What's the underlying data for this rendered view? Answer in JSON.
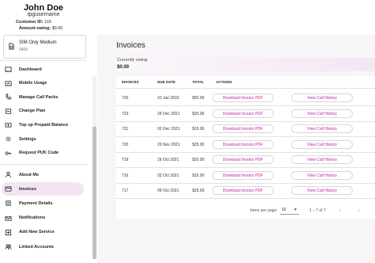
{
  "profile": {
    "name": "John Doe",
    "username": "tpgusername",
    "customer_id_label": "Customer ID:",
    "customer_id": "115",
    "amount_owing_label": "Amount owing:",
    "amount_owing": "$0.00"
  },
  "plan": {
    "name": "SIM Only Medium",
    "number": "0406",
    "icon": "sim-card-icon"
  },
  "nav_primary": [
    {
      "label": "Dashboard",
      "icon": "dashboard-icon"
    },
    {
      "label": "Mobile Usage",
      "icon": "usage-icon"
    },
    {
      "label": "Manage Call Packs",
      "icon": "call-packs-icon"
    },
    {
      "label": "Change Plan",
      "icon": "change-plan-icon"
    },
    {
      "label": "Top up Prepaid Balance",
      "icon": "top-up-icon"
    },
    {
      "label": "Settings",
      "icon": "gear-icon"
    },
    {
      "label": "Request PUK Code",
      "icon": "key-icon"
    }
  ],
  "nav_secondary": [
    {
      "label": "About Me",
      "icon": "person-icon"
    },
    {
      "label": "Invoices",
      "icon": "invoice-icon",
      "active": true
    },
    {
      "label": "Payment Details",
      "icon": "payment-icon"
    },
    {
      "label": "Notifications",
      "icon": "notifications-icon"
    },
    {
      "label": "Add New Service",
      "icon": "add-icon"
    },
    {
      "label": "Linked Accounts",
      "icon": "linked-accounts-icon"
    }
  ],
  "page": {
    "title": "Invoices",
    "owing_label": "Currently owing",
    "owing_value": "$0.00"
  },
  "table": {
    "headers": [
      "INVOICES",
      "DUE DATE",
      "TOTAL",
      "ACTIONS"
    ],
    "download_label": "Download Invoice PDF",
    "history_label": "View Call History",
    "rows": [
      {
        "invoice": "726",
        "due": "31 Jan 2022",
        "total": "$50.00"
      },
      {
        "invoice": "723",
        "due": "26 Dec 2021",
        "total": "$20.00"
      },
      {
        "invoice": "721",
        "due": "02 Dec 2021",
        "total": "$15.00"
      },
      {
        "invoice": "720",
        "due": "20 Nov 2021",
        "total": "$25.00"
      },
      {
        "invoice": "719",
        "due": "26 Oct 2021",
        "total": "$20.00"
      },
      {
        "invoice": "716",
        "due": "02 Oct 2021",
        "total": "$15.00"
      },
      {
        "invoice": "717",
        "due": "09 Oct 2021",
        "total": "$25.00"
      }
    ]
  },
  "pagination": {
    "items_per_page_label": "Items per page:",
    "items_per_page": "10",
    "range": "1 – 7 of 7",
    "prev_icon": "chevron-left-icon",
    "next_icon": "chevron-right-icon"
  },
  "colors": {
    "accent": "#c21ea8",
    "active_nav": "#f3e4f3",
    "panel_bg": "#f7f5f8"
  }
}
